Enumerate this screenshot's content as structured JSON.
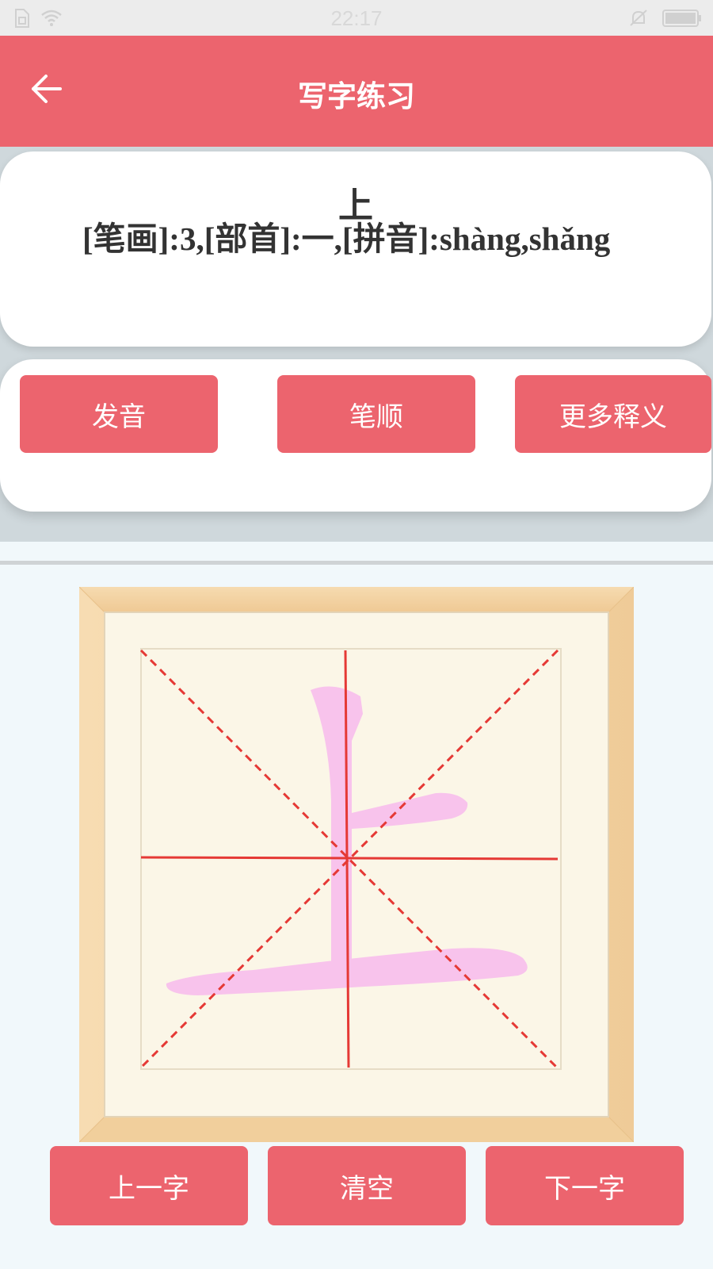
{
  "status_bar": {
    "time": "22:17",
    "icons": [
      "sim-icon",
      "wifi-icon",
      "mute-icon",
      "battery-icon"
    ]
  },
  "app_bar": {
    "title": "写字练习",
    "back_icon": "back-arrow-icon"
  },
  "character_info": {
    "character": "上",
    "detail": "[笔画]:3,[部首]:一,[拼音]:shàng,shǎng"
  },
  "actions": {
    "pronounce": "发音",
    "stroke_order": "笔顺",
    "more_definitions": "更多释义"
  },
  "writing_board": {
    "guide_character": "上",
    "guide_color": "#f8c3ec",
    "grid_line_color": "#e53935",
    "paper_color": "#fbf6e7",
    "frame_color": "#f3d2a4"
  },
  "bottom_actions": {
    "previous": "上一字",
    "clear": "清空",
    "next": "下一字"
  },
  "colors": {
    "accent": "#ec646e",
    "background": "#f1f8fb"
  }
}
